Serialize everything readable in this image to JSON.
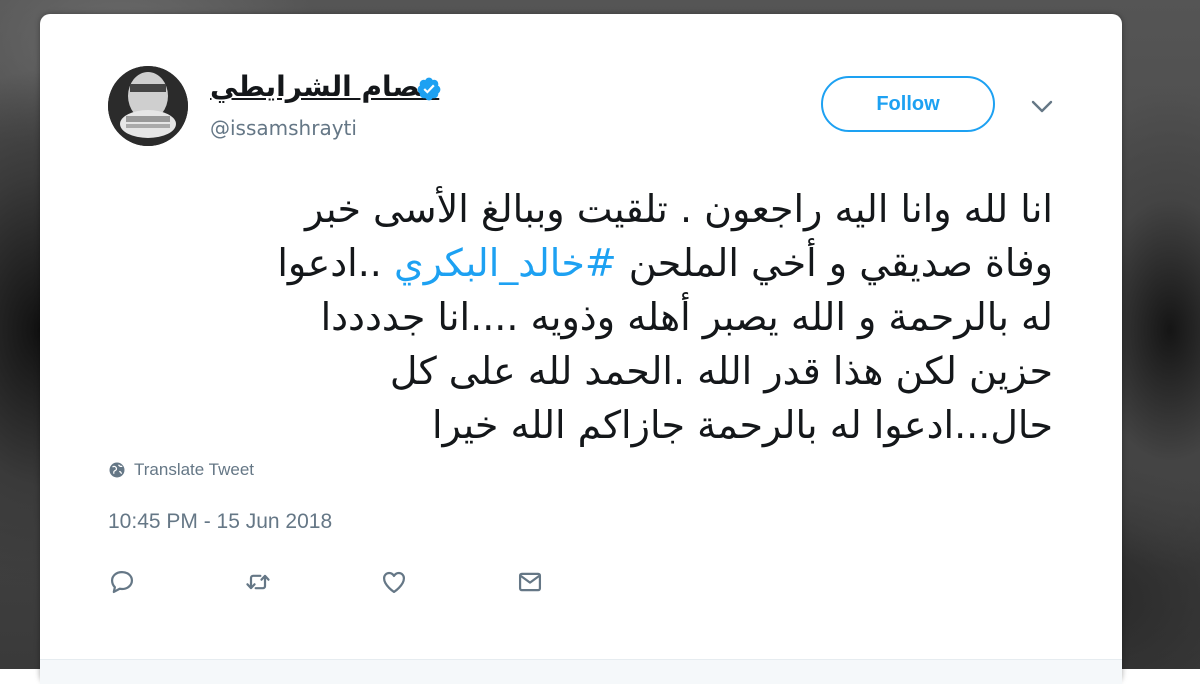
{
  "tweet": {
    "author": {
      "display_name": "عصام الشرايطي",
      "handle": "@issamshrayti",
      "verified": true,
      "avatar_icon": "avatar-photo"
    },
    "follow_label": "Follow",
    "menu_icon": "chevron-down-icon",
    "text_lines": [
      {
        "text": "انا لله وانا اليه راجعون . تلقيت وببالغ الأسى خبر"
      },
      {
        "before": "وفاة صديقي و أخي الملحن ",
        "hashtag": "#خالد_البكري",
        "after": " ..ادعوا"
      },
      {
        "text": "له بالرحمة و الله يصبر أهله وذويه ....انا جددددا"
      },
      {
        "text": "حزين لكن هذا قدر الله .الحمد لله على كل"
      },
      {
        "text": "حال...ادعوا له بالرحمة جازاكم الله خيرا"
      }
    ],
    "translate_label": "Translate Tweet",
    "timestamp": "10:45 PM - 15 Jun 2018",
    "actions": [
      "reply-icon",
      "retweet-icon",
      "like-icon",
      "direct-message-icon"
    ]
  },
  "colors": {
    "accent": "#1da1f2",
    "text": "#14171a",
    "muted": "#657786"
  }
}
